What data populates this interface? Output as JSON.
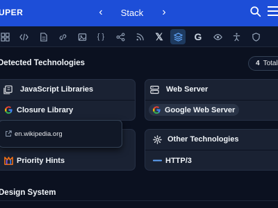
{
  "header": {
    "brand": "UPER",
    "title": "Stack",
    "prev_icon": "chevron-left-icon",
    "next_icon": "chevron-right-icon",
    "search_icon": "search-icon",
    "menu_icon": "hamburger-menu-icon",
    "color": "#1d4ed8"
  },
  "toolbar": {
    "icons": [
      "grid-icon",
      "code-icon",
      "document-icon",
      "link-icon",
      "image-icon",
      "braces-icon",
      "share-icon",
      "rss-icon",
      "x-twitter-icon",
      "layers-stack-icon",
      "google-icon",
      "eye-icon",
      "accessibility-icon",
      "shield-icon"
    ],
    "active": "layers-stack-icon"
  },
  "detected": {
    "title": "Detected Technologies",
    "total_count": "4",
    "total_label": "Total"
  },
  "cards": {
    "js": {
      "title": "JavaScript Libraries",
      "icon": "library-icon",
      "item": "Closure Library",
      "item_icon": "google-icon"
    },
    "web_server": {
      "title": "Web Server",
      "icon": "server-icon",
      "item": "Google Web Server",
      "item_icon": "google-icon"
    },
    "other": {
      "title": "Other Technologies",
      "icon": "gear-icon",
      "item": "HTTP/3",
      "item_icon": "http-icon"
    },
    "hints": {
      "item": "Priority Hints",
      "item_icon": "priority-hints-icon"
    }
  },
  "tooltip": {
    "icon": "external-link-icon",
    "url": "en.wikipedia.org"
  },
  "design": {
    "title": "Design System"
  },
  "colors": {
    "background": "#0b1120",
    "card": "#1a2233",
    "accent": "#60a5fa"
  }
}
